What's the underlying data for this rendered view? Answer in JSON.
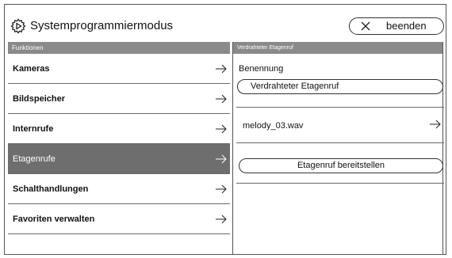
{
  "header": {
    "title": "Systemprogrammiermodus",
    "exit_label": "beenden",
    "gear_icon": "gear-icon",
    "close_icon": "close-icon"
  },
  "left_panel": {
    "section_title": "Funktionen",
    "items": [
      {
        "label": "Kameras",
        "selected": false
      },
      {
        "label": "Bildspeicher",
        "selected": false
      },
      {
        "label": "Internrufe",
        "selected": false
      },
      {
        "label": "Etagenrufe",
        "selected": true
      },
      {
        "label": "Schalthandlungen",
        "selected": false
      },
      {
        "label": "Favoriten verwalten",
        "selected": false
      }
    ]
  },
  "right_panel": {
    "section_title": "Verdrahteter Etagenruf",
    "name_label": "Benennung",
    "name_value": "Verdrahteter Etagenruf",
    "melody": "melody_03.wav",
    "provide_button": "Etagenruf bereitstellen"
  },
  "colors": {
    "header_bar": "#8a8a8a",
    "selected_bg": "#6e6e6e",
    "border": "#555555"
  }
}
